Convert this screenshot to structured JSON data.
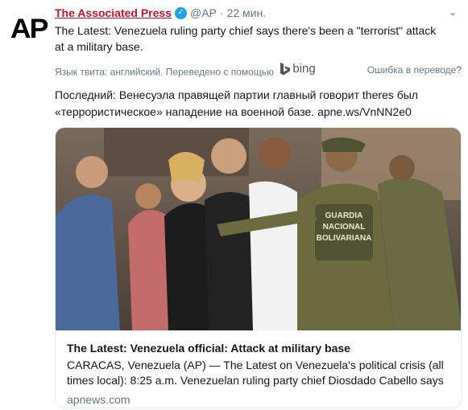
{
  "tweet": {
    "author_name": "The Associated Press",
    "handle": "@AP",
    "separator": "·",
    "time": "22 мин.",
    "text": "The Latest: Venezuela ruling party chief says there's been a \"terrorist\" attack at a military base.",
    "avatar_text": "AP"
  },
  "translation": {
    "language_note": "Язык твита: английский. Переведено с помощью",
    "provider": "bing",
    "error_link": "Ошибка в переводе?",
    "text": "Последний: Венесуэла правящей партии главный говорит theres был «террористическое» нападение на военной базе. apne.ws/VnNN2e0"
  },
  "card": {
    "title": "The Latest: Venezuela official: Attack at military base",
    "description": "CARACAS, Venezuela (AP) — The Latest on Venezuela's political crisis (all times local): 8:25 a.m. Venezuelan ruling party chief Diosdado Cabello says t",
    "domain": "apnews.com",
    "image_vest_text": [
      "GUARDIA",
      "NACIONAL",
      "BOLIVARIANA"
    ]
  },
  "colors": {
    "author": "#c4122f",
    "verified": "#1da1f2",
    "muted": "#657786",
    "border": "#e1e8ed"
  }
}
